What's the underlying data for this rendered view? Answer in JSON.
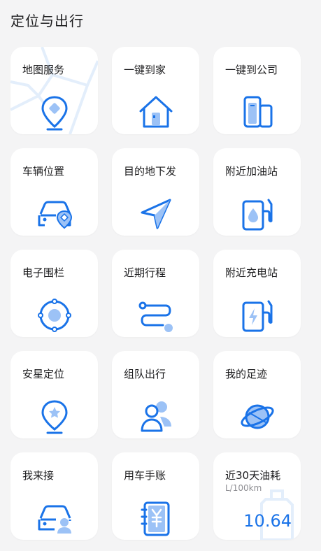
{
  "header": {
    "title": "定位与出行"
  },
  "colors": {
    "accent": "#1a73e8",
    "accent_light": "#9cc2f6",
    "card": "#ffffff",
    "bg": "#f4f4f5"
  },
  "cards": [
    {
      "label": "地图服务",
      "icon": "map-pin-icon"
    },
    {
      "label": "一键到家",
      "icon": "home-icon"
    },
    {
      "label": "一键到公司",
      "icon": "office-building-icon"
    },
    {
      "label": "车辆位置",
      "icon": "car-location-icon"
    },
    {
      "label": "目的地下发",
      "icon": "navigation-arrow-icon"
    },
    {
      "label": "附近加油站",
      "icon": "fuel-pump-icon"
    },
    {
      "label": "电子围栏",
      "icon": "geofence-icon"
    },
    {
      "label": "近期行程",
      "icon": "route-icon"
    },
    {
      "label": "附近充电站",
      "icon": "charging-station-icon"
    },
    {
      "label": "安星定位",
      "icon": "star-pin-icon"
    },
    {
      "label": "组队出行",
      "icon": "team-icon"
    },
    {
      "label": "我的足迹",
      "icon": "globe-footprint-icon"
    },
    {
      "label": "我来接",
      "icon": "car-person-icon"
    },
    {
      "label": "用车手账",
      "icon": "yuan-notebook-icon"
    },
    {
      "label": "近30天油耗",
      "sub": "L/100km",
      "value": "10.64",
      "icon": "fuel-can-icon"
    }
  ]
}
